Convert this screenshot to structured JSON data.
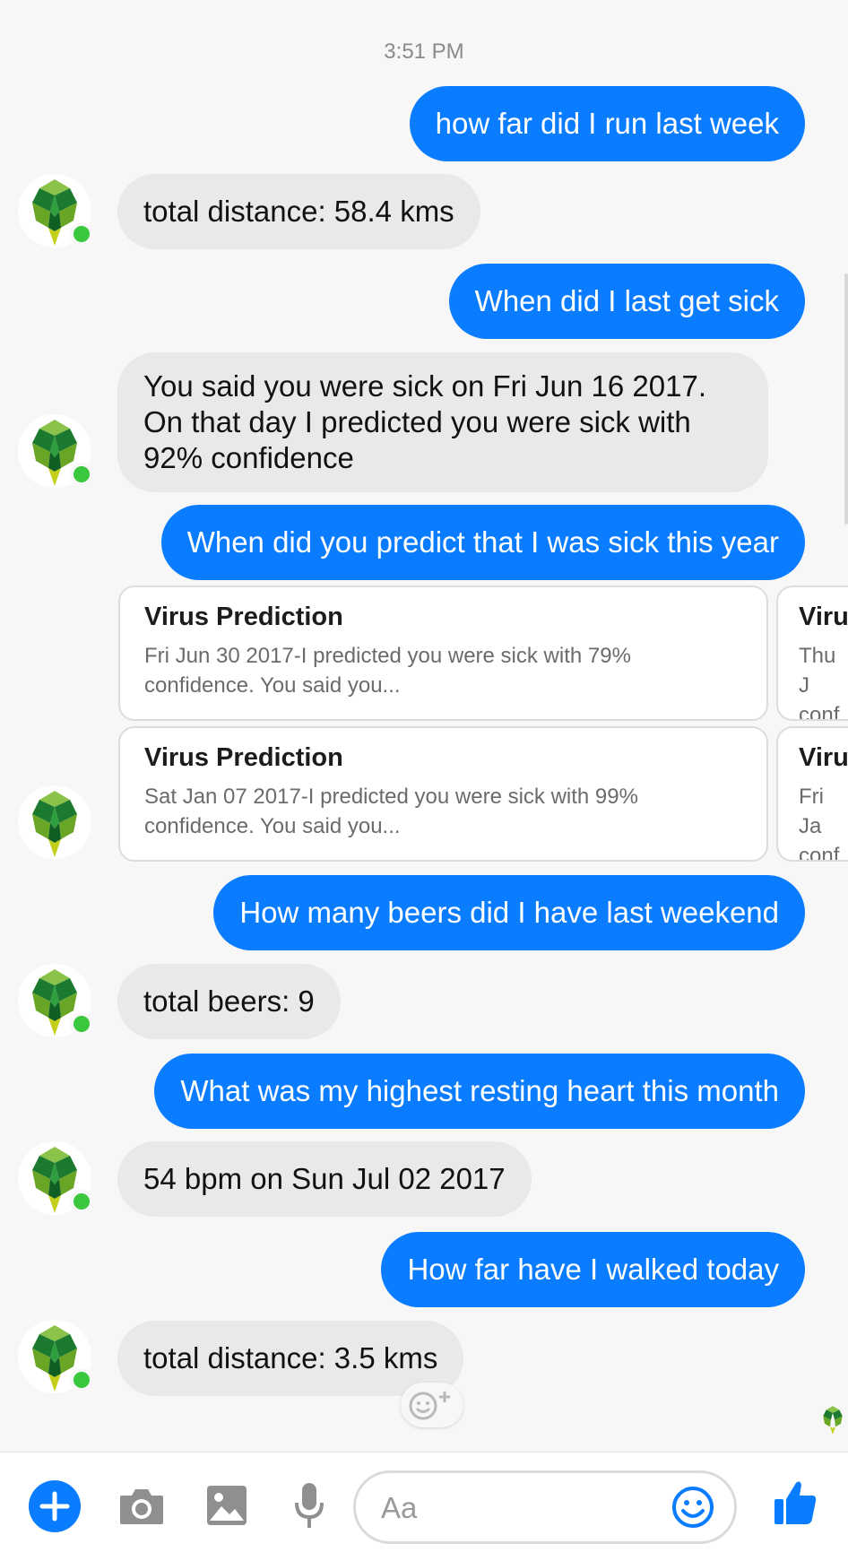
{
  "chat": {
    "timestamp": "3:51 PM",
    "messages": [
      {
        "dir": "out",
        "text": "how far did I run last week"
      },
      {
        "dir": "in",
        "text": "total distance: 58.4 kms"
      },
      {
        "dir": "out",
        "text": "When did I last get sick"
      },
      {
        "dir": "in",
        "text": "You said you were sick on Fri Jun 16 2017. On that day I predicted you were sick with 92% confidence"
      },
      {
        "dir": "out",
        "text": "When did you predict that I was sick this year"
      },
      {
        "dir": "out",
        "text": "How many beers did I have last weekend"
      },
      {
        "dir": "in",
        "text": "total beers: 9"
      },
      {
        "dir": "out",
        "text": "What was my highest resting heart this month"
      },
      {
        "dir": "in",
        "text": "54 bpm on Sun Jul 02 2017"
      },
      {
        "dir": "out",
        "text": "How far have I walked today"
      },
      {
        "dir": "in",
        "text": "total distance: 3.5 kms"
      }
    ],
    "cards": [
      {
        "title": "Virus Prediction",
        "body": "Fri Jun 30 2017-I predicted you were sick with 79% confidence. You said you..."
      },
      {
        "title": "Virus Prediction",
        "body": "Sat Jan 07 2017-I predicted you were sick with 99% confidence. You said you..."
      }
    ],
    "cards_partial": [
      {
        "title": "Viru",
        "line1": "Thu J",
        "line2": "conf"
      },
      {
        "title": "Viru",
        "line1": "Fri Ja",
        "line2": "conf"
      }
    ]
  },
  "composer": {
    "placeholder": "Aa"
  },
  "icons": {
    "add": "plus-circle-icon",
    "camera": "camera-icon",
    "gallery": "image-icon",
    "voice": "microphone-icon",
    "emoji": "smiley-icon",
    "like": "thumbs-up-icon",
    "react": "add-reaction-icon"
  },
  "colors": {
    "accent": "#0a7cff",
    "incoming_bubble": "#e9e9e9",
    "online": "#3ac73d"
  }
}
